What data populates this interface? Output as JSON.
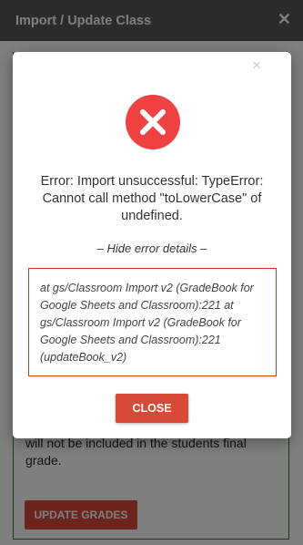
{
  "window": {
    "title": "Import / Update Class",
    "close_glyph": "✕"
  },
  "background": {
    "text": "will not be included in the students final grade.",
    "update_button": "UPDATE GRADES"
  },
  "dialog": {
    "close_glyph": "×",
    "icon": "error-x-icon",
    "message": "Error: Import unsuccessful: TypeError: Cannot call method \"toLowerCase\" of undefined.",
    "toggle_label": "–  Hide error details –",
    "details": "at gs/Classroom Import v2 (GradeBook for Google Sheets and Classroom):221 at gs/Classroom Import v2 (GradeBook for Google Sheets and Classroom):221 (updateBook_v2)",
    "close_button": "CLOSE"
  },
  "colors": {
    "titlebar": "#565656",
    "accent_red": "#d84a38",
    "error_icon": "#f04242",
    "border_green": "#2e7d32"
  }
}
